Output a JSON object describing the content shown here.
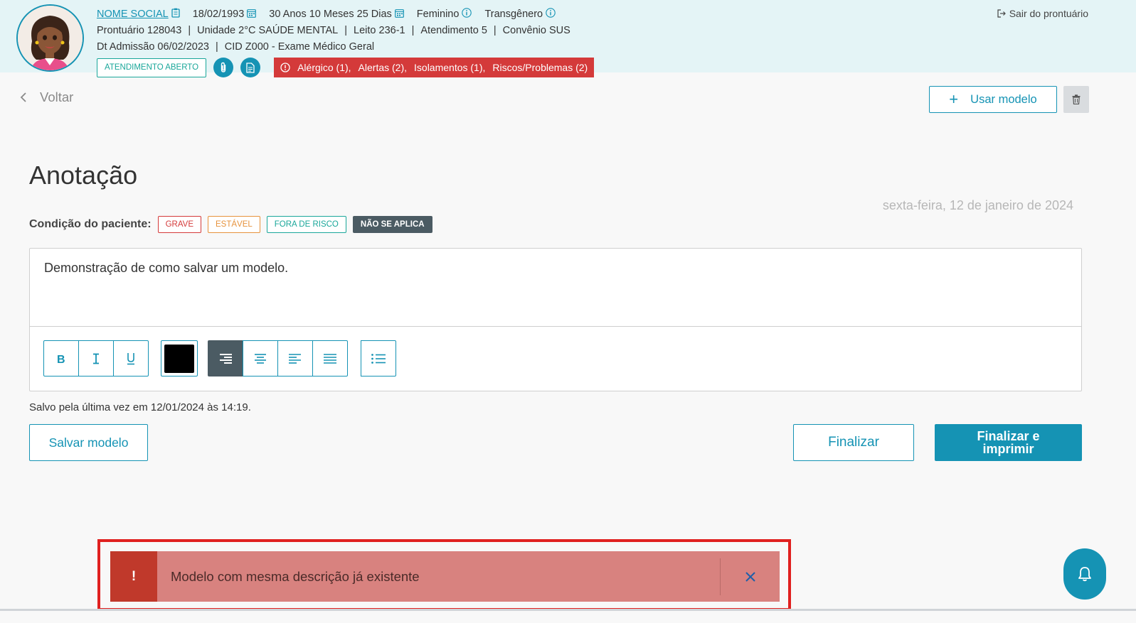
{
  "header": {
    "social_name": "NOME SOCIAL",
    "birth_date": "18/02/1993",
    "age": "30 Anos 10 Meses 25 Dias",
    "sex": "Feminino",
    "gender": "Transgênero",
    "line2": [
      "Prontuário 128043",
      "Unidade 2°C SAÚDE MENTAL",
      "Leito 236-1",
      "Atendimento 5",
      "Convênio SUS"
    ],
    "line3": [
      "Dt Admissão 06/02/2023",
      "CID Z000 - Exame Médico Geral"
    ],
    "attendance_tag": "ATENDIMENTO ABERTO",
    "alerts": [
      "Alérgico (1),",
      "Alertas (2),",
      "Isolamentos (1),",
      "Riscos/Problemas (2)"
    ],
    "logout_label": "Sair do prontuário",
    "separator": "|"
  },
  "toolbar": {
    "back_label": "Voltar",
    "use_model_label": "Usar modelo"
  },
  "main": {
    "title": "Anotação",
    "date": "sexta-feira, 12 de janeiro de 2024",
    "condition_label": "Condição do paciente:",
    "conditions": [
      "GRAVE",
      "ESTÁVEL",
      "FORA DE RISCO",
      "NÃO SE APLICA"
    ],
    "editor_text": "Demonstração de como salvar um modelo.",
    "saved_text": "Salvo pela última vez em 12/01/2024 às 14:19.",
    "save_model_label": "Salvar modelo",
    "finish_label": "Finalizar",
    "finish_print_label": "Finalizar e imprimir",
    "text_color": "#000000"
  },
  "toast": {
    "mark": "!",
    "message": "Modelo com mesma descrição já existente"
  },
  "colors": {
    "primary": "#1593b4",
    "danger": "#d43a3a",
    "warning": "#e6923c",
    "success": "#1aa79a",
    "dark": "#4b5b63",
    "toast_bg": "#d8827f"
  }
}
